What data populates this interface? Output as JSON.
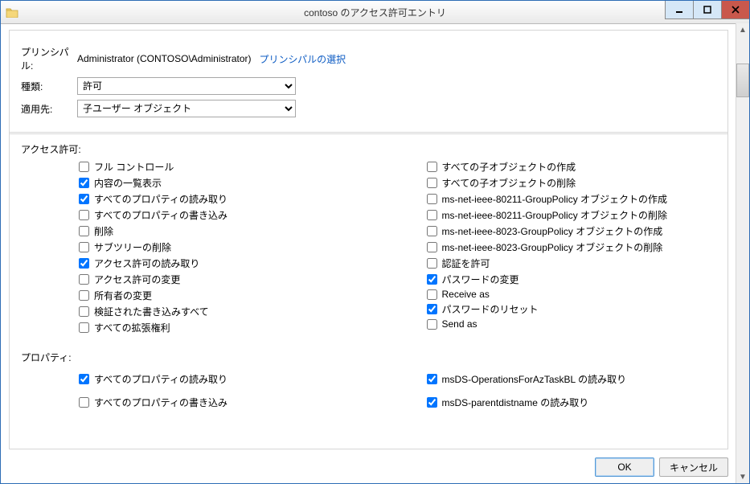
{
  "window": {
    "title": "contoso のアクセス許可エントリ"
  },
  "top": {
    "principal_label": "プリンシパル:",
    "principal_value": "Administrator (CONTOSO\\Administrator)",
    "select_principal_link": "プリンシパルの選択",
    "type_label": "種類:",
    "type_value": "許可",
    "applies_label": "適用先:",
    "applies_value": "子ユーザー オブジェクト"
  },
  "permissions": {
    "section_label": "アクセス許可:",
    "left": [
      {
        "label": "フル コントロール",
        "checked": false
      },
      {
        "label": "内容の一覧表示",
        "checked": true
      },
      {
        "label": "すべてのプロパティの読み取り",
        "checked": true
      },
      {
        "label": "すべてのプロパティの書き込み",
        "checked": false
      },
      {
        "label": "削除",
        "checked": false
      },
      {
        "label": "サブツリーの削除",
        "checked": false
      },
      {
        "label": "アクセス許可の読み取り",
        "checked": true
      },
      {
        "label": "アクセス許可の変更",
        "checked": false
      },
      {
        "label": "所有者の変更",
        "checked": false
      },
      {
        "label": "検証された書き込みすべて",
        "checked": false
      },
      {
        "label": "すべての拡張権利",
        "checked": false
      }
    ],
    "right": [
      {
        "label": "すべての子オブジェクトの作成",
        "checked": false
      },
      {
        "label": "すべての子オブジェクトの削除",
        "checked": false
      },
      {
        "label": "ms-net-ieee-80211-GroupPolicy オブジェクトの作成",
        "checked": false
      },
      {
        "label": "ms-net-ieee-80211-GroupPolicy オブジェクトの削除",
        "checked": false
      },
      {
        "label": "ms-net-ieee-8023-GroupPolicy オブジェクトの作成",
        "checked": false
      },
      {
        "label": "ms-net-ieee-8023-GroupPolicy オブジェクトの削除",
        "checked": false
      },
      {
        "label": "認証を許可",
        "checked": false
      },
      {
        "label": "パスワードの変更",
        "checked": true
      },
      {
        "label": "Receive as",
        "checked": false
      },
      {
        "label": "パスワードのリセット",
        "checked": true
      },
      {
        "label": "Send as",
        "checked": false
      }
    ]
  },
  "properties": {
    "section_label": "プロパティ:",
    "left": [
      {
        "label": "すべてのプロパティの読み取り",
        "checked": true
      },
      {
        "label": "すべてのプロパティの書き込み",
        "checked": false
      }
    ],
    "right": [
      {
        "label": "msDS-OperationsForAzTaskBL の読み取り",
        "checked": true
      },
      {
        "label": "msDS-parentdistname の読み取り",
        "checked": true
      }
    ]
  },
  "buttons": {
    "ok": "OK",
    "cancel": "キャンセル"
  }
}
